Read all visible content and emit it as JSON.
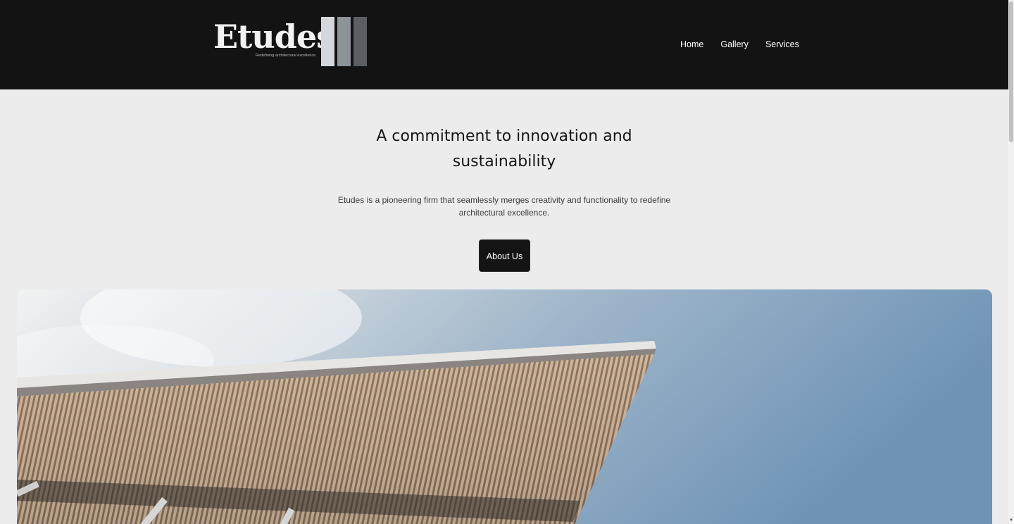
{
  "header": {
    "logo": {
      "wordmark": "Etudes",
      "tagline": "Redefining architectural excellence"
    },
    "nav": [
      {
        "label": "Home"
      },
      {
        "label": "Gallery"
      },
      {
        "label": "Services"
      }
    ]
  },
  "hero": {
    "title": "A commitment to innovation and sustainability",
    "description": "Etudes is a pioneering firm that seamlessly merges creativity and functionality to redefine architectural excellence.",
    "cta_label": "About Us"
  },
  "colors": {
    "header_bg": "#131313",
    "page_bg": "#ececec",
    "button_bg": "#141414"
  }
}
